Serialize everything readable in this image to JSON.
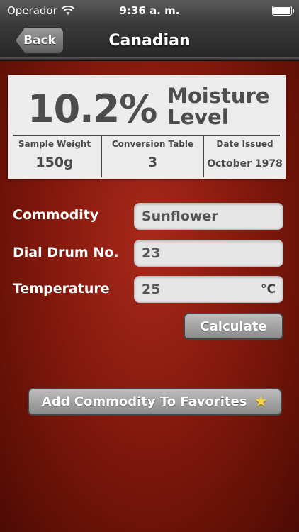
{
  "status": {
    "carrier": "Operador",
    "time": "9:36 a. m."
  },
  "nav": {
    "back_label": "Back",
    "title": "Canadian"
  },
  "result": {
    "value": "10.2%",
    "label_line1": "Moisture",
    "label_line2": "Level",
    "stats": [
      {
        "label": "Sample Weight",
        "value": "150g"
      },
      {
        "label": "Conversion Table",
        "value": "3"
      },
      {
        "label": "Date Issued",
        "value": "October 1978"
      }
    ]
  },
  "form": {
    "commodity_label": "Commodity",
    "commodity_value": "Sunflower",
    "dial_label": "Dial Drum No.",
    "dial_value": "23",
    "temp_label": "Temperature",
    "temp_value": "25",
    "temp_unit": "°C"
  },
  "actions": {
    "calculate_label": "Calculate",
    "favorites_label": "Add Commodity To Favorites",
    "favorites_icon": "star-icon"
  }
}
